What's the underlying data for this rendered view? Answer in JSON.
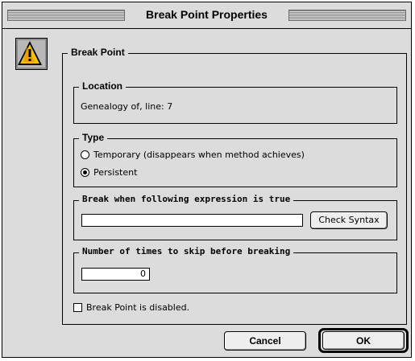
{
  "window": {
    "title": "Break Point Properties"
  },
  "icon": {
    "name": "caution-icon"
  },
  "groups": {
    "break_point": {
      "label": "Break Point"
    },
    "location": {
      "label": "Location",
      "value": "Genealogy of, line: 7"
    },
    "type": {
      "label": "Type",
      "options": [
        {
          "label": "Temporary (disappears when method achieves)",
          "selected": false
        },
        {
          "label": "Persistent",
          "selected": true
        }
      ]
    },
    "expression": {
      "label": "Break when following expression is true",
      "value": "",
      "check_syntax_label": "Check Syntax"
    },
    "skip": {
      "label": "Number of times to skip before breaking",
      "value": "0"
    }
  },
  "disabled_checkbox": {
    "label": "Break Point is disabled.",
    "checked": false
  },
  "buttons": {
    "cancel": "Cancel",
    "ok": "OK"
  },
  "colors": {
    "background": "#dcdcdc",
    "caution_yellow": "#f5c000"
  }
}
